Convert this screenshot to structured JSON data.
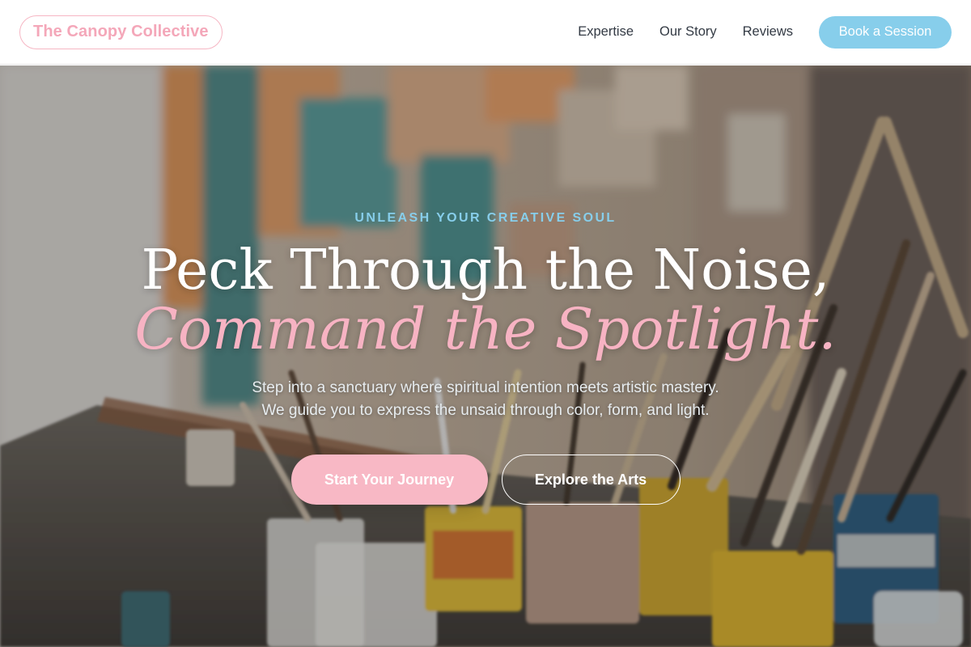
{
  "nav": {
    "logo": "The Canopy Collective",
    "links": [
      "Expertise",
      "Our Story",
      "Reviews"
    ],
    "cta": "Book a Session"
  },
  "hero": {
    "eyebrow": "UNLEASH YOUR CREATIVE SOUL",
    "headline_line1": "Peck Through the Noise,",
    "headline_line2": "Command the Spotlight.",
    "subtitle_line1": "Step into a sanctuary where spiritual intention meets artistic mastery.",
    "subtitle_line2": "We guide you to express the unsaid through color, form, and light.",
    "primary_cta": "Start Your Journey",
    "secondary_cta": "Explore the Arts"
  },
  "colors": {
    "brand_pink": "#f4a7b9",
    "accent_blue": "#87ceeb",
    "nav_text": "#333a44"
  }
}
